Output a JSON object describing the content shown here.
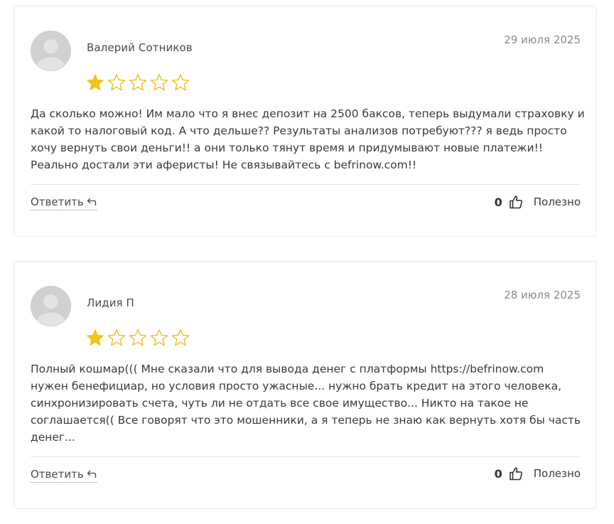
{
  "colors": {
    "star_filled": "#f0c419",
    "star_outline": "#e8be22",
    "avatar_bg": "#d2d2d2",
    "card_border": "#e9e9e9"
  },
  "reviews": [
    {
      "author": "Валерий Сотников",
      "date": "29 июля 2025",
      "rating": 1,
      "max_rating": 5,
      "text": "Да сколько можно! Им мало что я внес депозит на 2500 баксов, теперь выдумали страховку и какой то налоговый код. А что дельше?? Результаты анализов потребуют??? я ведь просто хочу вернуть свои деньги!! а они только тянут время и придумывают новые платежи!! Реально достали эти аферисты! Не связывайтесь с befrinow.com!!",
      "reply_label": "Ответить",
      "helpful_count": "0",
      "helpful_label": "Полезно"
    },
    {
      "author": "Лидия П",
      "date": "28 июля 2025",
      "rating": 1,
      "max_rating": 5,
      "text": "Полный кошмар((( Мне сказали что для вывода денег с платформы https://befrinow.com нужен бенефициар, но условия просто ужасные... нужно брать кредит на этого человека, синхронизировать счета, чуть ли не отдать все свое имущество... Никто на такое не соглашается(( Все говорят что это мошенники, а я теперь не знаю как вернуть хотя бы часть денег...",
      "reply_label": "Ответить",
      "helpful_count": "0",
      "helpful_label": "Полезно"
    }
  ]
}
